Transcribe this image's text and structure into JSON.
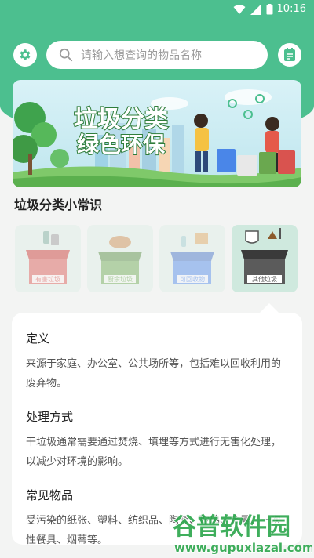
{
  "status": {
    "time": "10:16"
  },
  "search": {
    "placeholder": "请输入想查询的物品名称"
  },
  "section_title": "垃圾分类小常识",
  "banner": {
    "text": "垃圾分类绿色环保"
  },
  "categories": [
    {
      "label": "有害垃圾",
      "color": "#d9534f",
      "selected": false
    },
    {
      "label": "厨余垃圾",
      "color": "#6aa84f",
      "selected": false
    },
    {
      "label": "可回收物",
      "color": "#4a86e8",
      "selected": false
    },
    {
      "label": "其他垃圾",
      "color": "#5b5b5b",
      "selected": true
    }
  ],
  "detail": {
    "definition_title": "定义",
    "definition_text": "来源于家庭、办公室、公共场所等，包括难以回收利用的废弃物。",
    "method_title": "处理方式",
    "method_text": "干垃圾通常需要通过焚烧、填埋等方式进行无害化处理，以减少对环境的影响。",
    "items_title": "常见物品",
    "items_text": "受污染的纸张、塑料、纺织品、陶瓷、玻璃、金属、一次性餐具、烟蒂等。"
  },
  "watermark": {
    "line1": "谷普软件园",
    "line2": "www.gupuxlazal.com"
  },
  "colors": {
    "primary": "#4cbf8f"
  }
}
